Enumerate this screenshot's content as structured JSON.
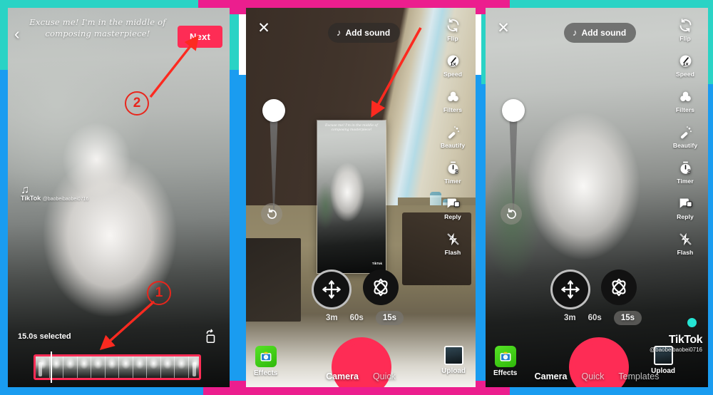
{
  "meta": {
    "title": "TikTok app screenshot tutorial — three panels",
    "colors": {
      "teal": "#2ad3c5",
      "blue": "#1a9cf0",
      "magenta": "#ec1e8e",
      "tiktok_red": "#fe2c55",
      "annotation_red": "#e8261c",
      "effects_green": "#2fb80a"
    }
  },
  "panel1": {
    "name": "video-editor-screen",
    "caption": "Excuse me! I'm in the middle of composing masterpiece!",
    "back_icon": "chevron-left-icon",
    "next_label": "Next",
    "watermark": {
      "note_icon": "tiktok-note-icon",
      "brand": "TikTok",
      "handle": "@baobeibaobei0716"
    },
    "selected_label": "15.0s selected",
    "rotate_icon": "rotate-crop-icon",
    "filmstrip_frames": 12,
    "annotations": [
      {
        "label": "1",
        "target": "filmstrip"
      },
      {
        "label": "2",
        "target": "next-button"
      }
    ]
  },
  "panel2": {
    "name": "camera-ar-placement-screen",
    "close_icon": "close-icon",
    "add_sound_label": "Add sound",
    "music_icon": "music-note-icon",
    "rail": [
      {
        "label": "Flip",
        "icon": "flip-camera-icon"
      },
      {
        "label": "Speed",
        "icon": "speed-1x-icon"
      },
      {
        "label": "Filters",
        "icon": "filters-circles-icon"
      },
      {
        "label": "Beautify",
        "icon": "beautify-wand-icon"
      },
      {
        "label": "Timer",
        "icon": "timer-3-icon"
      },
      {
        "label": "Reply",
        "icon": "reply-icon"
      },
      {
        "label": "Flash",
        "icon": "flash-off-icon"
      }
    ],
    "zoom_slider": {
      "icon": "zoom-slider-handle",
      "reset_icon": "reset-rotate-icon"
    },
    "ar_controls": [
      {
        "icon": "move-arrows-icon",
        "name": "ar-move-button",
        "active": true
      },
      {
        "icon": "rotate-3d-icon",
        "name": "ar-rotate-button",
        "active": false
      }
    ],
    "durations": [
      {
        "label": "3m",
        "selected": false
      },
      {
        "label": "60s",
        "selected": false
      },
      {
        "label": "15s",
        "selected": true
      }
    ],
    "effects_label": "Effects",
    "effects_icon": "effects-icon",
    "upload_label": "Upload",
    "upload_icon": "upload-thumbnail-icon",
    "shutter_icon": "record-button",
    "modes": [
      {
        "label": "Camera",
        "active": true
      },
      {
        "label": "Quick",
        "active": false
      }
    ],
    "ar_preview": {
      "caption": "Excuse me! I'm in the middle of composing masterpiece!",
      "watermark_brand": "TikTok",
      "watermark_handle": "@baobeibaobei0716"
    }
  },
  "panel3": {
    "name": "camera-ar-scaled-screen",
    "close_icon": "close-icon",
    "add_sound_label": "Add sound",
    "music_icon": "music-note-icon",
    "rail": [
      {
        "label": "Flip",
        "icon": "flip-camera-icon"
      },
      {
        "label": "Speed",
        "icon": "speed-1x-icon"
      },
      {
        "label": "Filters",
        "icon": "filters-circles-icon"
      },
      {
        "label": "Beautify",
        "icon": "beautify-wand-icon"
      },
      {
        "label": "Timer",
        "icon": "timer-3-icon"
      },
      {
        "label": "Reply",
        "icon": "reply-icon"
      },
      {
        "label": "Flash",
        "icon": "flash-off-icon"
      }
    ],
    "zoom_slider": {
      "icon": "zoom-slider-handle",
      "reset_icon": "reset-rotate-icon"
    },
    "ar_controls": [
      {
        "icon": "move-arrows-icon",
        "name": "ar-move-button",
        "active": true
      },
      {
        "icon": "rotate-3d-icon",
        "name": "ar-rotate-button",
        "active": false
      }
    ],
    "durations": [
      {
        "label": "3m",
        "selected": false
      },
      {
        "label": "60s",
        "selected": false
      },
      {
        "label": "15s",
        "selected": true
      }
    ],
    "effects_label": "Effects",
    "effects_icon": "effects-icon",
    "upload_label": "Upload",
    "upload_icon": "upload-thumbnail-icon",
    "shutter_icon": "record-button",
    "modes": [
      {
        "label": "Camera",
        "active": true
      },
      {
        "label": "Quick",
        "active": false
      },
      {
        "label": "Templates",
        "active": false
      }
    ],
    "watermark": {
      "brand": "TikTok",
      "handle": "@baobeibaobei0716"
    }
  }
}
